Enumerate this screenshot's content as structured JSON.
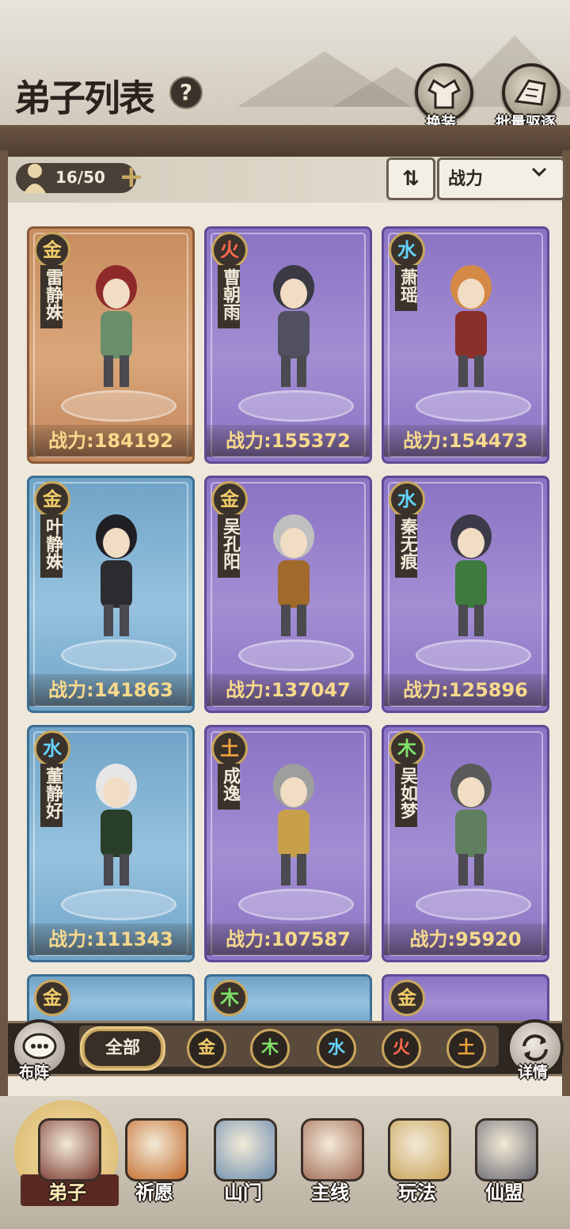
{
  "header": {
    "title": "弟子列表",
    "help_icon": "?",
    "buttons": [
      {
        "label": "换装",
        "icon": "outfit-icon"
      },
      {
        "label": "批量驱逐",
        "icon": "expel-icon"
      }
    ]
  },
  "toolbar": {
    "count": "16/50",
    "add_icon": "plus-icon",
    "sort_toggle_icon": "⇅",
    "sort_value": "战力",
    "sort_chevron": "⌄"
  },
  "disciples": [
    {
      "element": "金",
      "name": "雷静姝",
      "power": "战力:184192",
      "rarity": "orange",
      "element_color": "#f1cd6a"
    },
    {
      "element": "火",
      "name": "曹朝雨",
      "power": "战力:155372",
      "rarity": "purple",
      "element_color": "#ff6a4e"
    },
    {
      "element": "水",
      "name": "萧瑶",
      "power": "战力:154473",
      "rarity": "purple",
      "element_color": "#64d3ff"
    },
    {
      "element": "金",
      "name": "叶静姝",
      "power": "战力:141863",
      "rarity": "blue",
      "element_color": "#f1cd6a"
    },
    {
      "element": "金",
      "name": "吴孔阳",
      "power": "战力:137047",
      "rarity": "purple",
      "element_color": "#f1cd6a"
    },
    {
      "element": "水",
      "name": "秦无痕",
      "power": "战力:125896",
      "rarity": "purple",
      "element_color": "#64d3ff"
    },
    {
      "element": "水",
      "name": "董静好",
      "power": "战力:111343",
      "rarity": "blue",
      "element_color": "#64d3ff"
    },
    {
      "element": "土",
      "name": "成逸",
      "power": "战力:107587",
      "rarity": "purple",
      "element_color": "#f2a23c"
    },
    {
      "element": "木",
      "name": "吴如梦",
      "power": "战力:95920",
      "rarity": "purple",
      "element_color": "#7ee068"
    }
  ],
  "partial_cards": [
    {
      "element": "金",
      "rarity": "blue",
      "element_color": "#f1cd6a"
    },
    {
      "element": "木",
      "rarity": "blue",
      "element_color": "#7ee068"
    },
    {
      "element": "金",
      "rarity": "purple",
      "element_color": "#f1cd6a"
    }
  ],
  "filter": {
    "left_button": "布阵",
    "right_button": "详情",
    "all_label": "全部",
    "elements": [
      {
        "label": "金",
        "color": "#f1cd6a"
      },
      {
        "label": "木",
        "color": "#7ee068"
      },
      {
        "label": "水",
        "color": "#64d3ff"
      },
      {
        "label": "火",
        "color": "#ff6a4e"
      },
      {
        "label": "土",
        "color": "#f2a23c"
      }
    ]
  },
  "nav": {
    "items": [
      {
        "label": "弟子",
        "icon": "disciple-icon",
        "active": true
      },
      {
        "label": "祈愿",
        "icon": "wish-scroll-icon",
        "active": false
      },
      {
        "label": "山门",
        "icon": "gate-icon",
        "active": false
      },
      {
        "label": "主线",
        "icon": "main-quest-icon",
        "active": false
      },
      {
        "label": "玩法",
        "icon": "gameplay-icon",
        "active": false
      },
      {
        "label": "仙盟",
        "icon": "alliance-icon",
        "active": false
      }
    ]
  }
}
